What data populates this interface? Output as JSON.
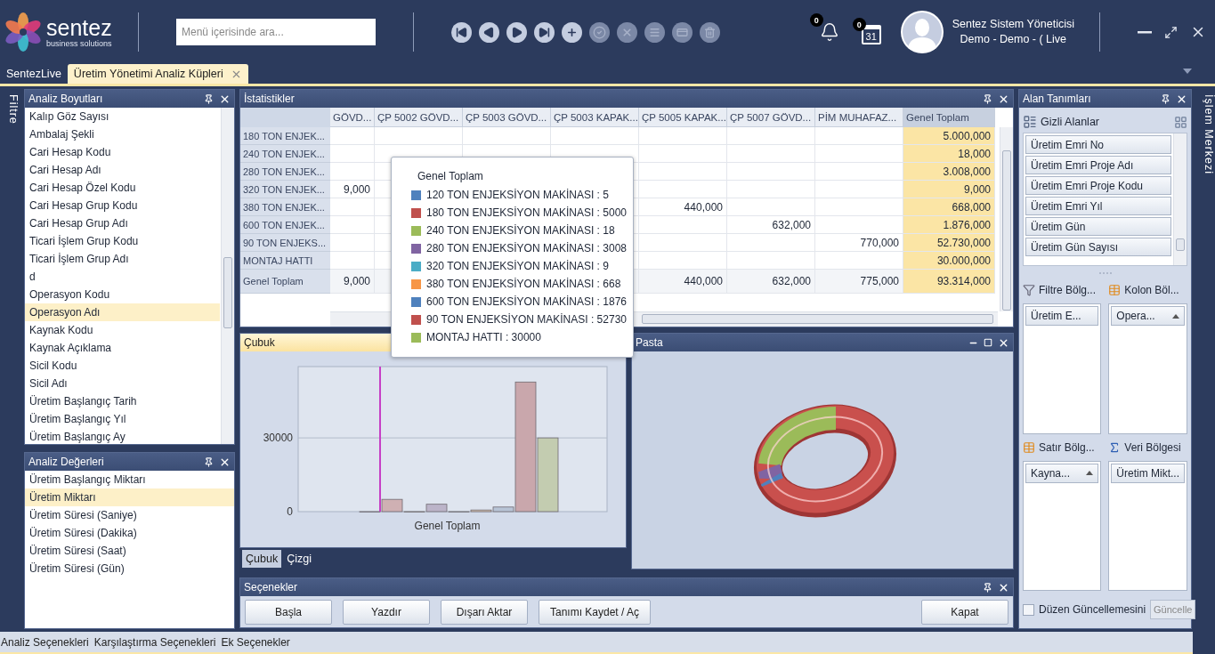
{
  "header": {
    "logo": {
      "name": "sentez",
      "tagline": "business solutions"
    },
    "search": {
      "placeholder": "Menü içerisinde ara..."
    },
    "toolbar": [
      {
        "kind": "first",
        "disabled": false
      },
      {
        "kind": "prev",
        "disabled": false
      },
      {
        "kind": "next",
        "disabled": false
      },
      {
        "kind": "last",
        "disabled": false
      },
      {
        "kind": "add",
        "disabled": false
      },
      {
        "kind": "approve",
        "disabled": true
      },
      {
        "kind": "cancel",
        "disabled": true
      },
      {
        "kind": "list",
        "disabled": true
      },
      {
        "kind": "card",
        "disabled": true
      },
      {
        "kind": "delete",
        "disabled": true
      }
    ],
    "notifications": {
      "count": "0"
    },
    "calendar": {
      "count": "0",
      "day": "31"
    },
    "user": {
      "name": "Sentez Sistem Yöneticisi",
      "context": "Demo - Demo - ( Live"
    }
  },
  "tabs": [
    {
      "label": "SentezLive",
      "selected": false,
      "closable": false
    },
    {
      "label": "Üretim Yönetimi Analiz Küpleri",
      "selected": true,
      "closable": true
    }
  ],
  "side_strips": {
    "left": "Filtre",
    "right": "İşlem Merkezi"
  },
  "dimensions": {
    "title": "Analiz Boyutları",
    "items": [
      {
        "label": "Kalıp Göz Sayısı",
        "selected": false
      },
      {
        "label": "Ambalaj Şekli",
        "selected": false
      },
      {
        "label": "Cari Hesap Kodu",
        "selected": false
      },
      {
        "label": "Cari Hesap Adı",
        "selected": false
      },
      {
        "label": "Cari Hesap Özel Kodu",
        "selected": false
      },
      {
        "label": "Cari Hesap Grup Kodu",
        "selected": false
      },
      {
        "label": "Cari Hesap Grup Adı",
        "selected": false
      },
      {
        "label": "Ticari İşlem Grup Kodu",
        "selected": false
      },
      {
        "label": "Ticari İşlem Grup Adı",
        "selected": false
      },
      {
        "label": "d",
        "selected": false
      },
      {
        "label": "Operasyon Kodu",
        "selected": false
      },
      {
        "label": "Operasyon Adı",
        "selected": true
      },
      {
        "label": "Kaynak Kodu",
        "selected": false
      },
      {
        "label": "Kaynak Açıklama",
        "selected": false
      },
      {
        "label": "Sicil Kodu",
        "selected": false
      },
      {
        "label": "Sicil Adı",
        "selected": false
      },
      {
        "label": "Üretim Başlangıç Tarih",
        "selected": false
      },
      {
        "label": "Üretim Başlangıç Yıl",
        "selected": false
      },
      {
        "label": "Üretim Başlangıç Ay",
        "selected": false
      }
    ]
  },
  "measures": {
    "title": "Analiz Değerleri",
    "items": [
      {
        "label": "Üretim Başlangıç Miktarı",
        "selected": false
      },
      {
        "label": "Üretim Miktarı",
        "selected": true
      },
      {
        "label": "Üretim Süresi (Saniye)",
        "selected": false
      },
      {
        "label": "Üretim Süresi (Dakika)",
        "selected": false
      },
      {
        "label": "Üretim Süresi (Saat)",
        "selected": false
      },
      {
        "label": "Üretim Süresi (Gün)",
        "selected": false
      }
    ]
  },
  "statistics": {
    "title": "İstatistikler",
    "columns": [
      {
        "label": "GÖVD...",
        "kind": "data"
      },
      {
        "label": "ÇP 5002 GÖVD...",
        "kind": "data"
      },
      {
        "label": "ÇP 5003 GÖVD...",
        "kind": "data"
      },
      {
        "label": "ÇP 5003 KAPAK...",
        "kind": "data"
      },
      {
        "label": "ÇP 5005 KAPAK...",
        "kind": "data"
      },
      {
        "label": "ÇP 5007 GÖVD...",
        "kind": "data"
      },
      {
        "label": "PİM MUHAFAZ...",
        "kind": "data"
      },
      {
        "label": "Genel Toplam",
        "kind": "total"
      }
    ],
    "rows": [
      {
        "label": "180 TON ENJEK...",
        "kind": "data",
        "cells": [
          null,
          null,
          null,
          null,
          null,
          null,
          null,
          "5.000,000"
        ]
      },
      {
        "label": "240 TON ENJEK...",
        "kind": "data",
        "cells": [
          null,
          null,
          null,
          null,
          null,
          null,
          null,
          "18,000"
        ]
      },
      {
        "label": "280 TON ENJEK...",
        "kind": "data",
        "cells": [
          null,
          null,
          null,
          null,
          null,
          null,
          null,
          "3.008,000"
        ]
      },
      {
        "label": "320 TON ENJEK...",
        "kind": "data",
        "cells": [
          "9,000",
          null,
          null,
          null,
          null,
          null,
          null,
          "9,000"
        ]
      },
      {
        "label": "380 TON ENJEK...",
        "kind": "data",
        "cells": [
          null,
          null,
          null,
          null,
          "440,000",
          null,
          null,
          "668,000"
        ]
      },
      {
        "label": "600 TON ENJEK...",
        "kind": "data",
        "cells": [
          null,
          null,
          null,
          null,
          null,
          "632,000",
          null,
          "1.876,000"
        ]
      },
      {
        "label": "90 TON ENJEKS...",
        "kind": "data",
        "cells": [
          null,
          null,
          null,
          null,
          null,
          null,
          "770,000",
          "52.730,000"
        ]
      },
      {
        "label": "MONTAJ HATTI",
        "kind": "data",
        "cells": [
          null,
          null,
          null,
          null,
          null,
          null,
          null,
          "30.000,000"
        ]
      },
      {
        "label": "Genel Toplam",
        "kind": "total",
        "cells": [
          "9,000",
          null,
          null,
          null,
          "440,000",
          "632,000",
          "775,000",
          "93.314,000"
        ]
      }
    ]
  },
  "bar_panel": {
    "title": "Çubuk",
    "chart_data": {
      "type": "bar",
      "categories": [
        "Genel Toplam"
      ],
      "ylim": [
        0,
        59000
      ],
      "yticks": [
        0,
        30000
      ],
      "series": [
        {
          "name": "120 TON ENJEKSİYON MAKİNASI",
          "color": "#b7c6dc",
          "values": [
            5
          ]
        },
        {
          "name": "180 TON ENJEKSİYON MAKİNASI",
          "color": "#cfb0b3",
          "values": [
            5000
          ]
        },
        {
          "name": "240 TON ENJEKSİYON MAKİNASI",
          "color": "#c9d3b6",
          "values": [
            18
          ]
        },
        {
          "name": "280 TON ENJEKSİYON MAKİNASI",
          "color": "#bcb4c9",
          "values": [
            3008
          ]
        },
        {
          "name": "320 TON ENJEKSİYON MAKİNASI",
          "color": "#b5cfd6",
          "values": [
            9
          ]
        },
        {
          "name": "380 TON ENJEKSİYON MAKİNASI",
          "color": "#dcc6b0",
          "values": [
            668
          ]
        },
        {
          "name": "600 TON ENJEKSİYON MAKİNASI",
          "color": "#b8c4d6",
          "values": [
            1876
          ]
        },
        {
          "name": "90 TON ENJEKSİYON MAKİNASI",
          "color": "#c9a7ac",
          "values": [
            52730
          ]
        },
        {
          "name": "MONTAJ HATTI",
          "color": "#c3ccb0",
          "values": [
            30000
          ]
        }
      ]
    },
    "tabs": [
      {
        "label": "Çubuk",
        "selected": true
      },
      {
        "label": "Çizgi",
        "selected": false
      }
    ]
  },
  "tooltip": {
    "title": "Genel Toplam",
    "items": [
      {
        "value": ": 5",
        "color": "#4f81bd"
      },
      {
        "value": ": 5000",
        "color": "#c0504d"
      },
      {
        "value": ": 18",
        "color": "#9bbb59"
      },
      {
        "value": ": 3008",
        "color": "#8064a2"
      },
      {
        "value": ": 9",
        "color": "#4bacc6"
      },
      {
        "value": ": 668",
        "color": "#f79646"
      },
      {
        "value": ": 1876",
        "color": "#4f81bd"
      },
      {
        "value": ": 52730",
        "color": "#c0504d"
      },
      {
        "value": ": 30000",
        "color": "#9bbb59"
      }
    ]
  },
  "pie_panel": {
    "title": "Pasta"
  },
  "options_panel": {
    "title": "Seçenekler",
    "buttons": [
      {
        "label": "Başla",
        "kind": "left"
      },
      {
        "label": "Yazdır",
        "kind": "left"
      },
      {
        "label": "Dışarı Aktar",
        "kind": "left"
      },
      {
        "label": "Tanımı Kaydet / Aç",
        "kind": "left"
      },
      {
        "label": "Kapat",
        "kind": "right"
      }
    ]
  },
  "field_list": {
    "title": "Alan Tanımları",
    "hidden_title": "Gizli Alanlar",
    "fields": [
      "Üretim Emri No",
      "Üretim Emri Proje Adı",
      "Üretim Emri Proje Kodu",
      "Üretim Emri Yıl",
      "Üretim Gün",
      "Üretim Gün Sayısı"
    ],
    "zones": [
      {
        "kind": "filter",
        "title": "Filtre Bölg...",
        "chip": "Üretim E...",
        "sorted": false
      },
      {
        "kind": "column",
        "title": "Kolon Böl...",
        "chip": "Opera...",
        "sorted": true
      },
      {
        "kind": "row",
        "title": "Satır Bölg...",
        "chip": "Kayna...",
        "sorted": true
      },
      {
        "kind": "data",
        "title": "Veri Bölgesi",
        "chip": "Üretim Mikt...",
        "sorted": false
      }
    ],
    "defer": {
      "label": "Düzen Güncellemesini",
      "checked": false
    },
    "update_button": "Güncelle"
  },
  "bottom_tabs": [
    "Analiz Seçenekleri",
    "Karşılaştırma Seçenekleri",
    "Ek Seçenekler"
  ]
}
